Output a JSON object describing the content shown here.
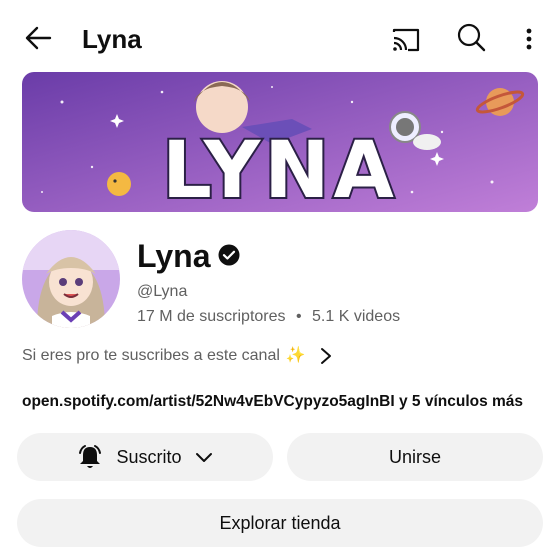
{
  "header": {
    "title": "Lyna",
    "icons": {
      "back": "arrow-left-icon",
      "cast": "cast-icon",
      "search": "search-icon",
      "more": "more-vertical-icon"
    }
  },
  "banner": {
    "text": "LYNA",
    "colors": {
      "bg_start": "#6a3ca8",
      "bg_end": "#c07fd8"
    }
  },
  "channel": {
    "name": "Lyna",
    "handle": "@Lyna",
    "subscribers": "17 M de suscriptores",
    "separator": "•",
    "videos": "5.1 K videos",
    "tagline": "Si eres pro te suscribes a este canal",
    "tagline_emoji": "✨",
    "links_url": "open.spotify.com/artist/52Nw4vEbVCypyzo5agInBI",
    "links_more": " y 5 vínculos más"
  },
  "actions": {
    "subscribed_label": "Suscrito",
    "join_label": "Unirse",
    "shop_label": "Explorar tienda"
  }
}
